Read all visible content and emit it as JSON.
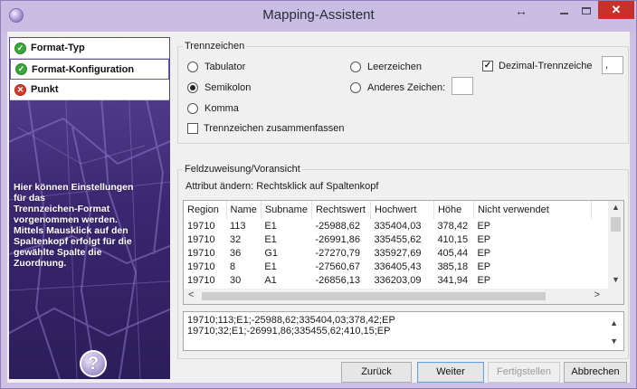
{
  "window": {
    "title": "Mapping-Assistent"
  },
  "steps": [
    {
      "label": "Format-Typ",
      "status": "ok"
    },
    {
      "label": "Format-Konfiguration",
      "status": "ok"
    },
    {
      "label": "Punkt",
      "status": "error"
    }
  ],
  "side": {
    "help_text": "Hier können Einstellungen\nfür das\nTrennzeichen-Format\nvorgenommen werden.\nMittels Mausklick auf den\nSpaltenkopf erfolgt für die\ngewählte Spalte die\nZuordnung.",
    "help_button": "?"
  },
  "separator": {
    "title": "Trennzeichen",
    "tab": "Tabulator",
    "semicolon": "Semikolon",
    "comma": "Komma",
    "space": "Leerzeichen",
    "other": "Anderes Zeichen:",
    "other_value": "",
    "decimal_label": "Dezimal-Trennzeiche",
    "decimal_checked": true,
    "decimal_value": ",",
    "merge": "Trennzeichen zusammenfassen",
    "selected": "semicolon"
  },
  "mapping": {
    "title": "Feldzuweisung/Voransicht",
    "hint": "Attribut ändern: Rechtsklick auf Spaltenkopf",
    "columns": [
      "Region",
      "Name",
      "Subname",
      "Rechtswert",
      "Hochwert",
      "Höhe",
      "Nicht verwendet"
    ],
    "rows": [
      [
        "19710",
        "113",
        "E1",
        "-25988,62",
        "335404,03",
        "378,42",
        "EP"
      ],
      [
        "19710",
        "32",
        "E1",
        "-26991,86",
        "335455,62",
        "410,15",
        "EP"
      ],
      [
        "19710",
        "36",
        "G1",
        "-27270,79",
        "335927,69",
        "405,44",
        "EP"
      ],
      [
        "19710",
        "8",
        "E1",
        "-27560,67",
        "336405,43",
        "385,18",
        "EP"
      ],
      [
        "19710",
        "30",
        "A1",
        "-26856,13",
        "336203,09",
        "341,94",
        "EP"
      ]
    ],
    "preview": [
      "19710;113;E1;-25988,62;335404,03;378,42;EP",
      "19710;32;E1;-26991,86;335455,62;410,15;EP"
    ]
  },
  "buttons": {
    "back": "Zurück",
    "next": "Weiter",
    "finish": "Fertigstellen",
    "cancel": "Abbrechen"
  }
}
